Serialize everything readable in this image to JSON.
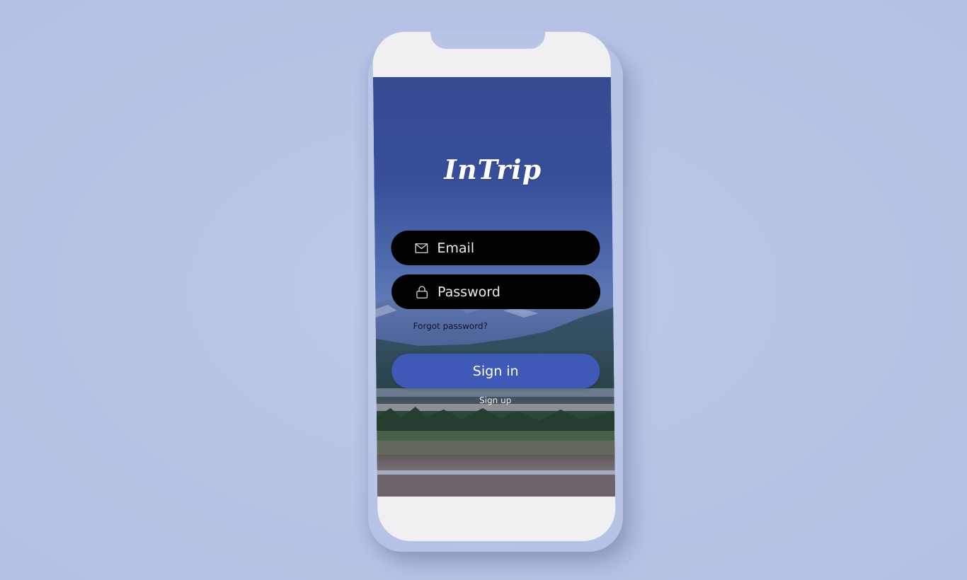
{
  "app": {
    "logo_text": "InTrip"
  },
  "login_form": {
    "email_placeholder": "Email",
    "password_placeholder": "Password",
    "forgot_password_label": "Forgot password?",
    "sign_in_label": "Sign in",
    "sign_up_label": "Sign up"
  },
  "icons": {
    "email": "envelope-icon",
    "password": "lock-icon"
  },
  "colors": {
    "background": "#b9c5e6",
    "primary_button": "#3f59b6",
    "input_background": "#000000",
    "phone_frame": "#f0eff1"
  }
}
